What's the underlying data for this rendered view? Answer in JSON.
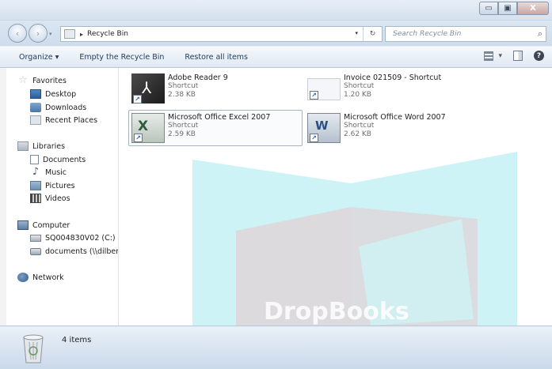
{
  "titlebar": {
    "buttons": [
      {
        "name": "minimize",
        "glyph": "▭"
      },
      {
        "name": "maximize",
        "glyph": "▣"
      },
      {
        "name": "close",
        "glyph": "X"
      }
    ]
  },
  "address": {
    "back_glyph": "‹",
    "forward_glyph": "›",
    "crumb_glyph": "▸",
    "path": "Recycle Bin",
    "drop_glyph": "▾",
    "refresh_glyph": "↻",
    "search_placeholder": "Search Recycle Bin",
    "search_glyph": "⌕"
  },
  "toolbar": {
    "organize": "Organize ▾",
    "empty": "Empty the Recycle Bin",
    "restore": "Restore all items",
    "views_drop": "▾",
    "help_glyph": "?"
  },
  "nav": {
    "favorites": {
      "label": "Favorites",
      "items": [
        "Desktop",
        "Downloads",
        "Recent Places"
      ]
    },
    "libraries": {
      "label": "Libraries",
      "items": [
        "Documents",
        "Music",
        "Pictures",
        "Videos"
      ]
    },
    "computer": {
      "label": "Computer",
      "items": [
        "SQ004830V02 (C:)",
        "documents (\\\\dilbert\\"
      ]
    },
    "network": {
      "label": "Network"
    }
  },
  "files": [
    {
      "name": "Adobe Reader 9",
      "type": "Shortcut",
      "size": "2.38 KB",
      "icon": "adobe-reader-icon"
    },
    {
      "name": "Invoice 021509 - Shortcut",
      "type": "Shortcut",
      "size": "1.20 KB",
      "icon": "document-shortcut-icon"
    },
    {
      "name": "Microsoft Office Excel 2007",
      "type": "Shortcut",
      "size": "2.59 KB",
      "icon": "excel-icon"
    },
    {
      "name": "Microsoft Office Word 2007",
      "type": "Shortcut",
      "size": "2.62 KB",
      "icon": "word-icon"
    }
  ],
  "watermark": {
    "text": "DropBooks"
  },
  "status": {
    "count": "4 items"
  },
  "colors": {
    "accent": "#1e395b",
    "watermark_cyan": "#bdeff4",
    "watermark_red": "#e6c9cc"
  }
}
